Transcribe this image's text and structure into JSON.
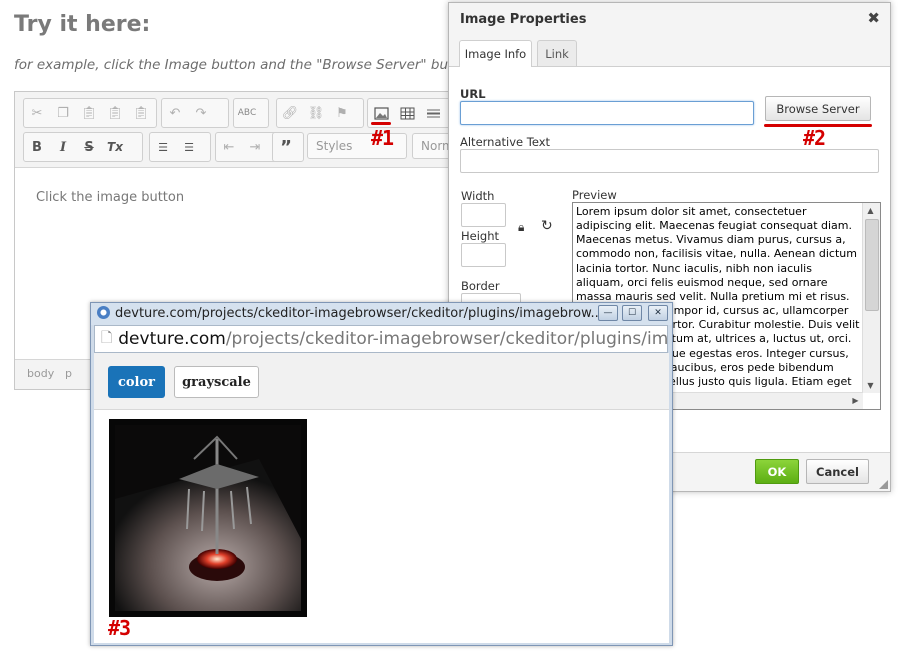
{
  "page": {
    "heading": "Try it here:",
    "subtext": "for example, click the Image button and the \"Browse Server\" button a"
  },
  "editor": {
    "toolbar": {
      "spellcheck_label": "ABC",
      "styles_label": "Styles",
      "format_label": "Norma",
      "bold_label": "B",
      "italic_label": "I",
      "strike_label": "S",
      "removeformat_label": "Tx",
      "blockquote_label": "”"
    },
    "content_text": "Click the image button",
    "status_path": [
      "body",
      "p"
    ]
  },
  "annotations": {
    "one": "#1",
    "two": "#2",
    "three": "#3"
  },
  "dialog": {
    "title": "Image Properties",
    "close_icon": "✖",
    "tabs": [
      {
        "label": "Image Info",
        "active": true
      },
      {
        "label": "Link",
        "active": false
      }
    ],
    "url_label": "URL",
    "url_value": "",
    "browse_button": "Browse Server",
    "alt_label": "Alternative Text",
    "alt_value": "",
    "width_label": "Width",
    "height_label": "Height",
    "border_label": "Border",
    "preview_label": "Preview",
    "preview_text": "Lorem ipsum dolor sit amet, consectetuer adipiscing elit. Maecenas feugiat consequat diam. Maecenas metus. Vivamus diam purus, cursus a, commodo non, facilisis vitae, nulla. Aenean dictum lacinia tortor. Nunc iaculis, nibh non iaculis aliquam, orci felis euismod neque, sed ornare massa mauris sed velit. Nulla pretium mi et risus. Fusce mi pede, tempor id, cursus ac, ullamcorper nec, enim. Sed tortor. Curabitur molestie. Duis velit augue, condimentum at, ultrices a, luctus ut, orci. Donec pellentesque egestas eros. Integer cursus, augue in cursus faucibus, eros pede bibendum sem, in tempus tellus justo quis ligula. Etiam eget tortor.",
    "ok_button": "OK",
    "cancel_button": "Cancel"
  },
  "popup": {
    "title": "devture.com/projects/ckeditor-imagebrowser/ckeditor/plugins/imagebrow...",
    "address_domain": "devture.com",
    "address_path": "/projects/ckeditor-imagebrowser/ckeditor/plugins/imagebr",
    "filters": [
      {
        "label": "color",
        "active": true
      },
      {
        "label": "grayscale",
        "active": false
      }
    ],
    "colors": {
      "active_filter": "#1a73b8",
      "ok_green": "#6bbf1a",
      "annotation_red": "#d40000"
    }
  }
}
